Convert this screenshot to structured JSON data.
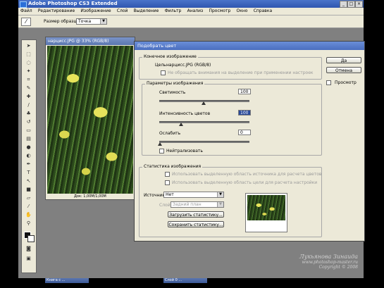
{
  "app": {
    "title": "Adobe Photoshop CS3 Extended"
  },
  "menu": [
    "Файл",
    "Редактирование",
    "Изображение",
    "Слой",
    "Выделение",
    "Фильтр",
    "Анализ",
    "Просмотр",
    "Окно",
    "Справка"
  ],
  "options_bar": {
    "sample_size_label": "Размер образца:",
    "sample_size_value": "Точка"
  },
  "document": {
    "title": "нарцисс.JPG @ 33% (RGB/8)",
    "status": "Док: 1,00М/1,00М"
  },
  "dialog": {
    "title": "Подобрать цвет",
    "target": {
      "group_label": "Конечное изображение",
      "target_label": "Цель:",
      "target_value": "нарцисс.JPG (RGB/8)",
      "ignore_selection": "Не обращать внимания на выделение при применении настроек"
    },
    "image_options": {
      "group_label": "Параметры изображения",
      "luminance_label": "Светимость",
      "luminance_value": "100",
      "color_intensity_label": "Интенсивность цветов",
      "color_intensity_value": "100",
      "fade_label": "Ослабить",
      "fade_value": "0",
      "neutralize_label": "Нейтрализовать"
    },
    "statistics": {
      "group_label": "Статистика изображения",
      "use_source_selection": "Использовать выделенную область источника для расчета цветов",
      "use_target_selection": "Использовать выделенную область цели для расчета настройки",
      "source_label": "Источник:",
      "source_value": "Нет",
      "layer_label": "Слой:",
      "layer_value": "Задний план",
      "load_button": "Загрузить статистику...",
      "save_button": "Сохранить статистику..."
    },
    "ok_button": "Да",
    "cancel_button": "Отмена",
    "preview_label": "Просмотр"
  },
  "watermark": {
    "name": "Лукьянова Зинаида",
    "site": "www.photoshop-master.ru",
    "copyright": "Copyright © 2008"
  },
  "bottom_windows": [
    "Книга с ...",
    "Слой 0 ..."
  ]
}
